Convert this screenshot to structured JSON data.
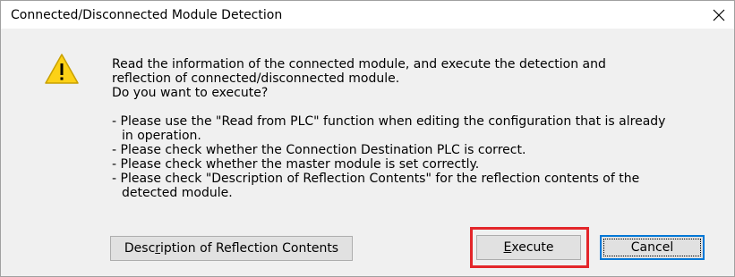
{
  "window": {
    "title": "Connected/Disconnected Module Detection",
    "close_glyph": "✕"
  },
  "icon": {
    "name": "warning-icon",
    "color_fill": "#fcd116",
    "color_stroke": "#c8a000",
    "glyph": "!"
  },
  "message": {
    "intro": [
      "Read the information of the connected module, and execute the detection and",
      "reflection of connected/disconnected module.",
      "Do you want to execute?"
    ],
    "notes": [
      "- Please use the \"Read from PLC\" function when editing the configuration that is already",
      "in operation.",
      "- Please check whether the Connection Destination PLC is correct.",
      "- Please check whether the master module is set correctly.",
      "- Please check \"Description of Reflection Contents\" for the reflection contents of the",
      "detected module."
    ]
  },
  "buttons": {
    "description": {
      "label_before": "Desc",
      "label_accel": "r",
      "label_after": "iption of Reflection Contents"
    },
    "execute": {
      "label_before": "",
      "label_accel": "E",
      "label_after": "xecute"
    },
    "cancel": {
      "label": "Cancel"
    }
  },
  "colors": {
    "highlight": "#e3262a",
    "focus": "#0078d7",
    "dialog_bg": "#f0f0f0",
    "button_bg": "#e1e1e1"
  }
}
